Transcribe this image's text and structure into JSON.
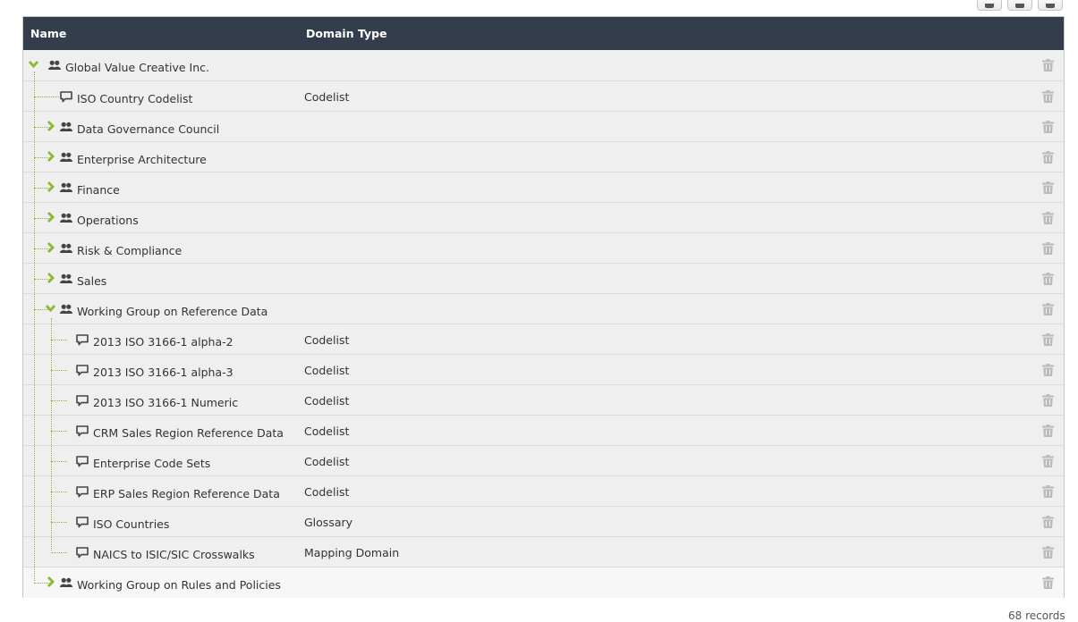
{
  "toolbar": {
    "buttons": [
      "edit-icon",
      "edit-icon",
      "add-icon"
    ]
  },
  "table": {
    "columns": [
      "Name",
      "Domain Type"
    ],
    "rows": [
      {
        "name": "Global Value Creative Inc.",
        "type": "",
        "kind": "community",
        "level": 0,
        "expander": "expanded"
      },
      {
        "name": "ISO Country Codelist",
        "type": "Codelist",
        "kind": "domain",
        "level": 1,
        "expander": "none"
      },
      {
        "name": "Data Governance Council",
        "type": "",
        "kind": "community",
        "level": 1,
        "expander": "collapsed"
      },
      {
        "name": "Enterprise Architecture",
        "type": "",
        "kind": "community",
        "level": 1,
        "expander": "collapsed"
      },
      {
        "name": "Finance",
        "type": "",
        "kind": "community",
        "level": 1,
        "expander": "collapsed"
      },
      {
        "name": "Operations",
        "type": "",
        "kind": "community",
        "level": 1,
        "expander": "collapsed"
      },
      {
        "name": "Risk & Compliance",
        "type": "",
        "kind": "community",
        "level": 1,
        "expander": "collapsed"
      },
      {
        "name": "Sales",
        "type": "",
        "kind": "community",
        "level": 1,
        "expander": "collapsed"
      },
      {
        "name": "Working Group on Reference Data",
        "type": "",
        "kind": "community",
        "level": 1,
        "expander": "expanded"
      },
      {
        "name": "2013 ISO 3166-1 alpha-2",
        "type": "Codelist",
        "kind": "domain",
        "level": 2,
        "expander": "none"
      },
      {
        "name": "2013 ISO 3166-1 alpha-3",
        "type": "Codelist",
        "kind": "domain",
        "level": 2,
        "expander": "none"
      },
      {
        "name": "2013 ISO 3166-1 Numeric",
        "type": "Codelist",
        "kind": "domain",
        "level": 2,
        "expander": "none"
      },
      {
        "name": "CRM Sales Region Reference Data",
        "type": "Codelist",
        "kind": "domain",
        "level": 2,
        "expander": "none"
      },
      {
        "name": "Enterprise Code Sets",
        "type": "Codelist",
        "kind": "domain",
        "level": 2,
        "expander": "none"
      },
      {
        "name": "ERP Sales Region Reference Data",
        "type": "Codelist",
        "kind": "domain",
        "level": 2,
        "expander": "none"
      },
      {
        "name": "ISO Countries",
        "type": "Glossary",
        "kind": "domain",
        "level": 2,
        "expander": "none"
      },
      {
        "name": "NAICS to ISIC/SIC Crosswalks",
        "type": "Mapping Domain",
        "kind": "domain",
        "level": 2,
        "expander": "none"
      },
      {
        "name": "Working Group on Rules and Policies",
        "type": "",
        "kind": "community",
        "level": 1,
        "expander": "collapsed"
      }
    ]
  },
  "footer": {
    "records": "68 records"
  },
  "colors": {
    "header_bg": "#343d4b",
    "accent_green": "#8bb82e",
    "row_bg": "#efefef",
    "trash": "#bbbbbb",
    "icon": "#444444"
  }
}
